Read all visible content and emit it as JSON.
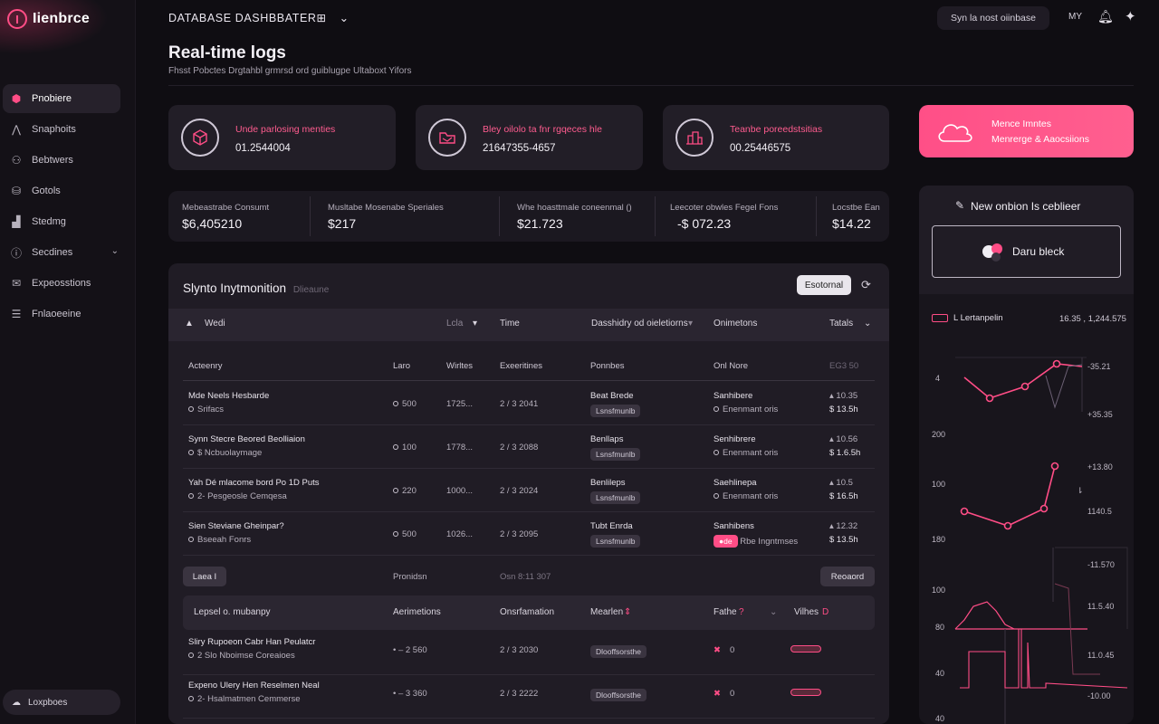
{
  "sidebar": {
    "logo": "Iienbrce",
    "items": [
      {
        "label": "Pnobiere",
        "icon": "hexagon-icon",
        "active": true
      },
      {
        "label": "Snaphoits",
        "icon": "chart-icon"
      },
      {
        "label": "Bebtwers",
        "icon": "user-icon"
      },
      {
        "label": "Gotols",
        "icon": "database-icon"
      },
      {
        "label": "Stedmg",
        "icon": "bars-icon"
      },
      {
        "label": "Secdines",
        "icon": "info-icon"
      },
      {
        "label": "Expeosstions",
        "icon": "mail-icon"
      },
      {
        "label": "Fnlaoeeine",
        "icon": "list-icon"
      }
    ],
    "footer": "Loxpboes"
  },
  "topbar": {
    "title": "DATABASE DASHBBATER⊞",
    "button": "Syn la nost oiinbase",
    "lang": "MY"
  },
  "page": {
    "title": "Real-time logs",
    "subtitle": "Fhsst Pobctes Drgtahbl grmrsd ord guiblugpe Ultaboxt Yifors"
  },
  "stats": [
    {
      "label": "Unde parlosing menties",
      "value": "01.2544004"
    },
    {
      "label": "Bley oilolo ta fnr rgqeces hle",
      "value": "21647355-4657"
    },
    {
      "label": "Teanbe poreedstsitias",
      "value": "00.25446575"
    }
  ],
  "promo": {
    "line1": "Mence Imntes",
    "line2": "Menrerge & Aaocsiions"
  },
  "metrics": [
    {
      "label": "Mebeastrabe Consumt",
      "value": "$6,405210"
    },
    {
      "label": "Musltabe Mosenabe Speriales",
      "value": "$217"
    },
    {
      "label": "Whe hoasttmale coneenmal ()",
      "value": "$21.723"
    },
    {
      "label": "Leecoter obwles Fegel Fons",
      "value": "-$ 072.23"
    },
    {
      "label": "Locstbe Ean",
      "value": "$14.22"
    }
  ],
  "table": {
    "title": "Slynto Inytmonition",
    "title_tag": "Dlieaune",
    "button": "Esotornal",
    "headers": [
      "Wedi",
      "Lcla",
      "Time",
      "Dasshidry od oieletiorns",
      "Onimetons",
      "Tatals"
    ],
    "subheaders": [
      "Acteenry",
      "Laro",
      "Wirltes",
      "Exeeritines",
      "Ponnbes",
      "Onl Nore",
      "EG3 50"
    ],
    "rows": [
      {
        "name": "Mde Neels Hesbarde",
        "sub": "Srifacs",
        "lvl": "500",
        "w": "1725...",
        "date": "2 / 3 2041",
        "p1": "Beat Brede",
        "p1tag": "Lsnsfmunlb",
        "o1": "Sanhibere",
        "o2": "Enenmant oris",
        "t1": "▴ 10.35",
        "t2": "$ 13.5h"
      },
      {
        "name": "Synn Stecre Beored Beolliaion",
        "sub": "$ Ncbuolaymage",
        "lvl": "100",
        "w": "1778...",
        "date": "2 / 3 2088",
        "p1": "Benllaps",
        "p1tag": "Lsnsfmunlb",
        "o1": "Senhibrere",
        "o2": "Enenmant oris",
        "t1": "▴ 10.56",
        "t2": "$ 1.6.5h"
      },
      {
        "name": "Yah Dé mlacome bord Po 1D Puts",
        "sub": "2- Pesgeosle Cemqesa",
        "lvl": "220",
        "w": "1000...",
        "date": "2 / 3 2024",
        "p1": "Benlileps",
        "p1tag": "Lsnsfmunlb",
        "o1": "Saehlinepa",
        "o2": "Enenmant oris",
        "t1": "▴ 10.5",
        "t2": "$ 16.5h"
      },
      {
        "name": "Sien Steviane Gheinpar?",
        "sub": "Bseeah Fonrs",
        "lvl": "500",
        "w": "1026...",
        "date": "2 / 3 2095",
        "p1": "Tubt Enrda",
        "p1tag": "Lsnsfmunlb",
        "o1": "Sanhibens",
        "o2": "Rbe Ingntmses",
        "o2pill": "●de",
        "t1": "▴ 12.32",
        "t2": "$ 13.5h"
      }
    ],
    "footer": {
      "left": "Laea I",
      "mid1": "Pronidsn",
      "mid2": "Osn 8:11 307",
      "right": "Reoaord"
    },
    "headers2": [
      "Lepsel o. mubanpy",
      "Aerimetions",
      "Onsrfamation",
      "Mearlen",
      "Fathe",
      "Vilhes"
    ],
    "rows2": [
      {
        "name": "Sliry Rupoeon Cabr Han Peulatcr",
        "sub": "2 Slo Nboimse Coreaioes",
        "a": "• – 2 560",
        "d": "2 / 3 2030",
        "tag": "Dlooffsorsthe",
        "f": "0"
      },
      {
        "name": "Expeno Ulery Hen Reselmen Neal",
        "sub": "2- Hsalmatmen Cemmerse",
        "a": "• – 3 360",
        "d": "2 / 3 2222",
        "tag": "Dlooffsorsthe",
        "f": "0"
      }
    ]
  },
  "right_panel": {
    "title": "New onbion Is ceblieer",
    "theme": "Daru bleck",
    "legend": "L Lertanpelin",
    "legend_value": "16.35 , 1,244.575",
    "y_left": [
      "4",
      "200",
      "100",
      "180",
      "100",
      "80",
      "40",
      "40"
    ],
    "y_right": [
      "-35.21",
      "+35.35",
      "+13.80",
      "1140.5",
      "-11.570",
      "11.5.40",
      "11.0.45",
      "-10.00"
    ]
  },
  "colors": {
    "accent": "#ff4d86",
    "bg": "#0f0d12",
    "card": "#221e27"
  }
}
